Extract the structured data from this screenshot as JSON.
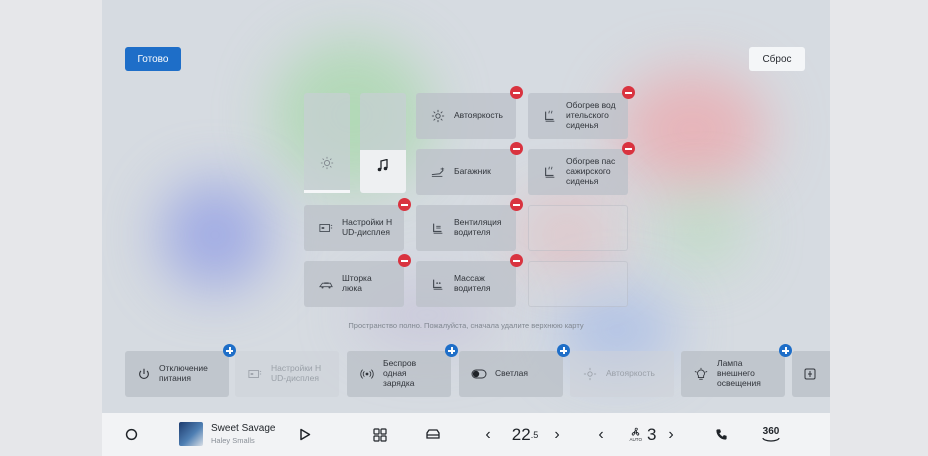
{
  "header": {
    "done_label": "Готово",
    "reset_label": "Сброс"
  },
  "grid": {
    "tiles": [
      {
        "id": "auto-brightness",
        "label": "Автояркость",
        "icon": "brightness-icon"
      },
      {
        "id": "driver-seat-heating",
        "label": "Обогрев вод ительского сиденья",
        "icon": "seat-heating-icon"
      },
      {
        "id": "trunk",
        "label": "Багажник",
        "icon": "trunk-icon"
      },
      {
        "id": "passenger-seat-heating",
        "label": "Обогрев пас сажирского сиденья",
        "icon": "seat-heating-icon"
      },
      {
        "id": "hud-settings",
        "label": "Настройки H UD-дисплея",
        "icon": "hud-icon"
      },
      {
        "id": "driver-ventilation",
        "label": "Вентиляция водителя",
        "icon": "seat-ventilation-icon"
      },
      {
        "id": "sunroof-shade",
        "label": "Шторка люка",
        "icon": "sunroof-icon"
      },
      {
        "id": "driver-massage",
        "label": "Массаж водителя",
        "icon": "seat-massage-icon"
      }
    ],
    "sliders": [
      {
        "id": "brightness",
        "icon": "sun-icon"
      },
      {
        "id": "volume",
        "icon": "music-note-icon"
      }
    ],
    "full_message": "Пространство полно. Пожалуйста, сначала удалите верхнюю карту"
  },
  "tray": [
    {
      "id": "power-off",
      "label": "Отключение питания",
      "icon": "power-icon",
      "enabled": true
    },
    {
      "id": "hud-settings-tray",
      "label": "Настройки H UD-дисплея",
      "icon": "hud-icon",
      "enabled": false
    },
    {
      "id": "wireless-charging",
      "label": "Беспров одная зарядка",
      "icon": "wireless-charging-icon",
      "enabled": true
    },
    {
      "id": "light-theme",
      "label": "Светлая",
      "icon": "theme-toggle-icon",
      "enabled": true
    },
    {
      "id": "auto-brightness-tray",
      "label": "Автояркость",
      "icon": "brightness-icon",
      "enabled": false
    },
    {
      "id": "exterior-light",
      "label": "Лампа внешнего освещения",
      "icon": "lamp-icon",
      "enabled": true
    }
  ],
  "dock": {
    "track_title": "Sweet Savage",
    "track_artist": "Haley Smalls",
    "temperature_whole": "22",
    "temperature_fraction": ".5",
    "fan_speed": "3",
    "fan_mode": "AUTO",
    "view_360_label": "360"
  },
  "colors": {
    "accent": "#1e6ec8",
    "remove": "#d9333f"
  }
}
